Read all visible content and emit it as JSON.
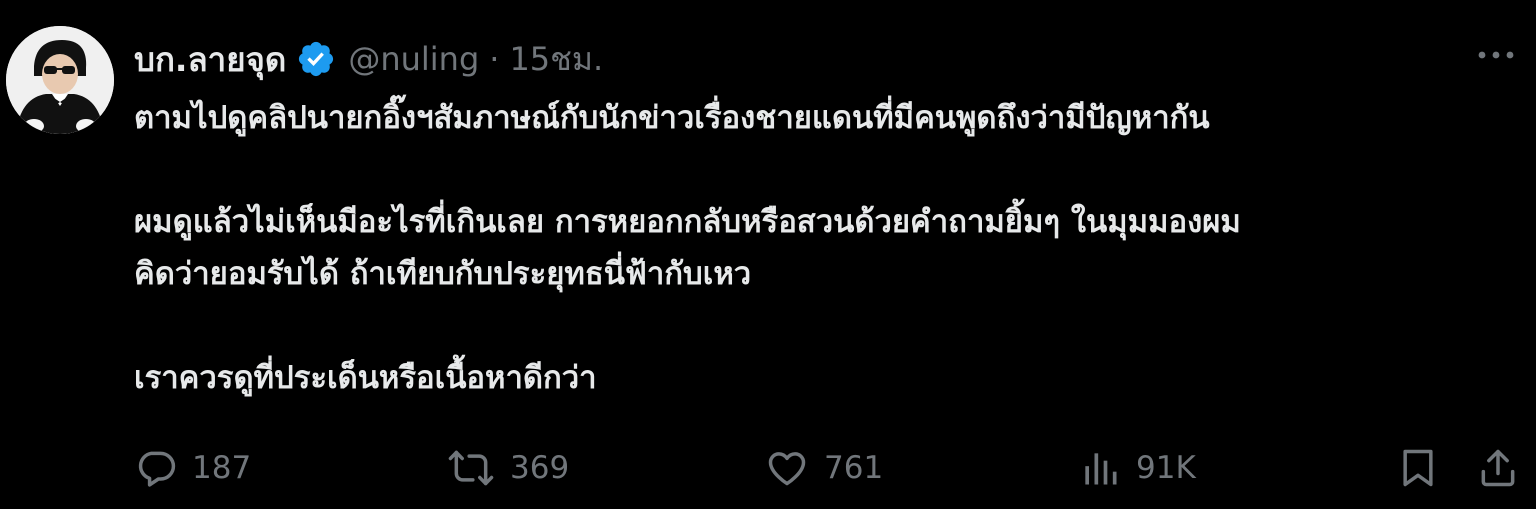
{
  "tweet": {
    "author": {
      "display_name": "บก.ลายจุด",
      "handle": "@nuling",
      "verified": true,
      "avatar": "profile-photo"
    },
    "separator": "·",
    "time": "15ชม.",
    "body": [
      "ตามไปดูคลิปนายกอิ๊งฯสัมภาษณ์กับนักข่าวเรื่องชายแดนที่มีคนพูดถึงว่ามีปัญหากัน",
      "ผมดูแล้วไม่เห็นมีอะไรที่เกินเลย การหยอกกลับหรือสวนด้วยคำถามยิ้มๆ ในมุมมองผม",
      "คิดว่ายอมรับได้ ถ้าเทียบกับประยุทธนี่ฟ้ากับเหว",
      "เราควรดูที่ประเด็นหรือเนื้อหาดีกว่า"
    ],
    "stats": {
      "replies": "187",
      "reposts": "369",
      "likes": "761",
      "views": "91K"
    }
  },
  "icons": {
    "more": "more-horizontal-icon",
    "reply": "speech-bubble-icon",
    "repost": "repost-arrows-icon",
    "like": "heart-icon",
    "views": "bar-chart-icon",
    "bookmark": "bookmark-icon",
    "share": "share-upload-icon"
  },
  "colors": {
    "background": "#000000",
    "text": "#e7e9ea",
    "muted": "#71767b",
    "verified": "#1d9bf0"
  }
}
